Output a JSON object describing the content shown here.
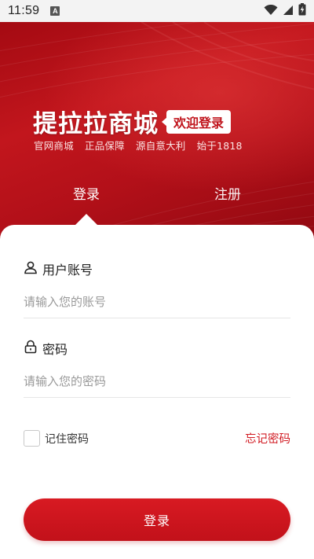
{
  "status_bar": {
    "time": "11:59",
    "notification_letter": "A",
    "icons": [
      "wifi-icon",
      "signal-icon",
      "battery-charging-icon"
    ]
  },
  "hero": {
    "brand_title": "提拉拉商城",
    "welcome_badge": "欢迎登录",
    "slogan": [
      "官网商城",
      "正品保障",
      "源自意大利",
      "始于1818"
    ]
  },
  "tabs": [
    {
      "label": "登录",
      "active": true
    },
    {
      "label": "注册",
      "active": false
    }
  ],
  "form": {
    "account": {
      "label": "用户账号",
      "icon": "user-icon",
      "placeholder": "请输入您的账号",
      "value": ""
    },
    "password": {
      "label": "密码",
      "icon": "lock-icon",
      "placeholder": "请输入您的密码",
      "value": ""
    },
    "remember": {
      "label": "记住密码",
      "checked": false
    },
    "forgot_label": "忘记密码",
    "submit_label": "登录"
  },
  "colors": {
    "brand_red": "#c2111a",
    "link_red": "#d11a22",
    "placeholder_gray": "#9a9a9a"
  }
}
